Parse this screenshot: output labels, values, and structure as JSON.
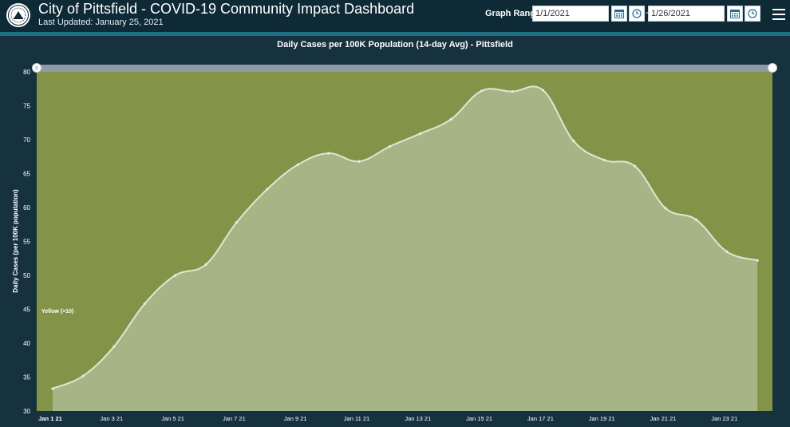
{
  "header": {
    "title": "City of Pittsfield - COVID-19 Community Impact Dashboard",
    "last_updated": "Last Updated: January 25, 2021",
    "graph_range_label": "Graph Range",
    "start_date": "1/1/2021",
    "end_date": "1/26/2021",
    "range_separator": "-"
  },
  "colors": {
    "header_bg": "#0d2a36",
    "accent": "#1e6e84",
    "zone_yellow": "#839449",
    "area_fill": "#a6b586",
    "line": "#dfe6d2"
  },
  "chart_data": {
    "type": "area",
    "title": "Daily Cases per 100K Population (14-day Avg) - Pittsfield",
    "xlabel": "",
    "ylabel": "Daily Cases (per 100K population)",
    "ylim": [
      30,
      80
    ],
    "yticks": [
      30,
      35,
      40,
      45,
      50,
      55,
      60,
      65,
      70,
      75,
      80
    ],
    "zone_label": "Yellow (>10)",
    "grid": false,
    "x_tick_labels": [
      "Jan 1 21",
      "Jan 3 21",
      "Jan 5 21",
      "Jan 7 21",
      "Jan 9 21",
      "Jan 11 21",
      "Jan 13 21",
      "Jan 15 21",
      "Jan 17 21",
      "Jan 19 21",
      "Jan 21 21",
      "Jan 23 21"
    ],
    "x": [
      "2021-01-01",
      "2021-01-02",
      "2021-01-03",
      "2021-01-04",
      "2021-01-05",
      "2021-01-06",
      "2021-01-07",
      "2021-01-08",
      "2021-01-09",
      "2021-01-10",
      "2021-01-11",
      "2021-01-12",
      "2021-01-13",
      "2021-01-14",
      "2021-01-15",
      "2021-01-16",
      "2021-01-17",
      "2021-01-18",
      "2021-01-19",
      "2021-01-20",
      "2021-01-21",
      "2021-01-22",
      "2021-01-23",
      "2021-01-24"
    ],
    "series": [
      {
        "values": [
          33.3,
          35.2,
          39.5,
          45.8,
          50.0,
          51.6,
          57.8,
          62.7,
          66.3,
          68.0,
          66.8,
          69.0,
          70.9,
          73.0,
          77.2,
          77.1,
          77.3,
          69.8,
          67.0,
          66.1,
          59.9,
          58.2,
          53.5,
          52.2
        ]
      }
    ]
  }
}
